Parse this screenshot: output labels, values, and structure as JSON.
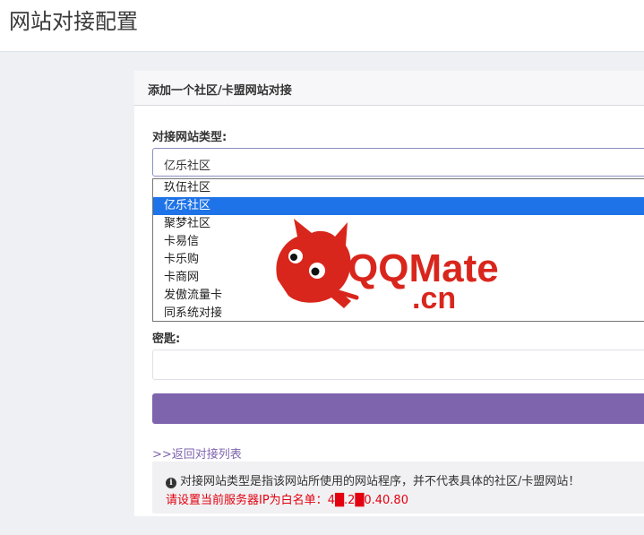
{
  "header": {
    "title": "网站对接配置"
  },
  "panel": {
    "heading": "添加一个社区/卡盟网站对接",
    "type_label": "对接网站类型:",
    "selected_type": "亿乐社区",
    "options": [
      "玖伍社区",
      "亿乐社区",
      "聚梦社区",
      "卡易信",
      "卡乐购",
      "卡商网",
      "发傲流量卡",
      "同系统对接"
    ],
    "selected_index": 1,
    "secret_label": "密匙:",
    "secret_value": "",
    "submit_label": "",
    "back_link": ">>返回对接列表"
  },
  "note": {
    "info_icon": "info-circle-icon",
    "line1": "对接网站类型是指该网站所使用的网站程序，并不代表具体的社区/卡盟网站！",
    "line2_prefix": "请设置当前服务器IP为白名单：",
    "line2_ip": "4█.2█0.40.80"
  },
  "watermark": {
    "text_main": "QQMate",
    "text_sub": ".cn",
    "color": "#d9261c"
  },
  "colors": {
    "accent": "#7e63ad",
    "selected_option": "#1e73e8",
    "warning_text": "#e3000f"
  }
}
